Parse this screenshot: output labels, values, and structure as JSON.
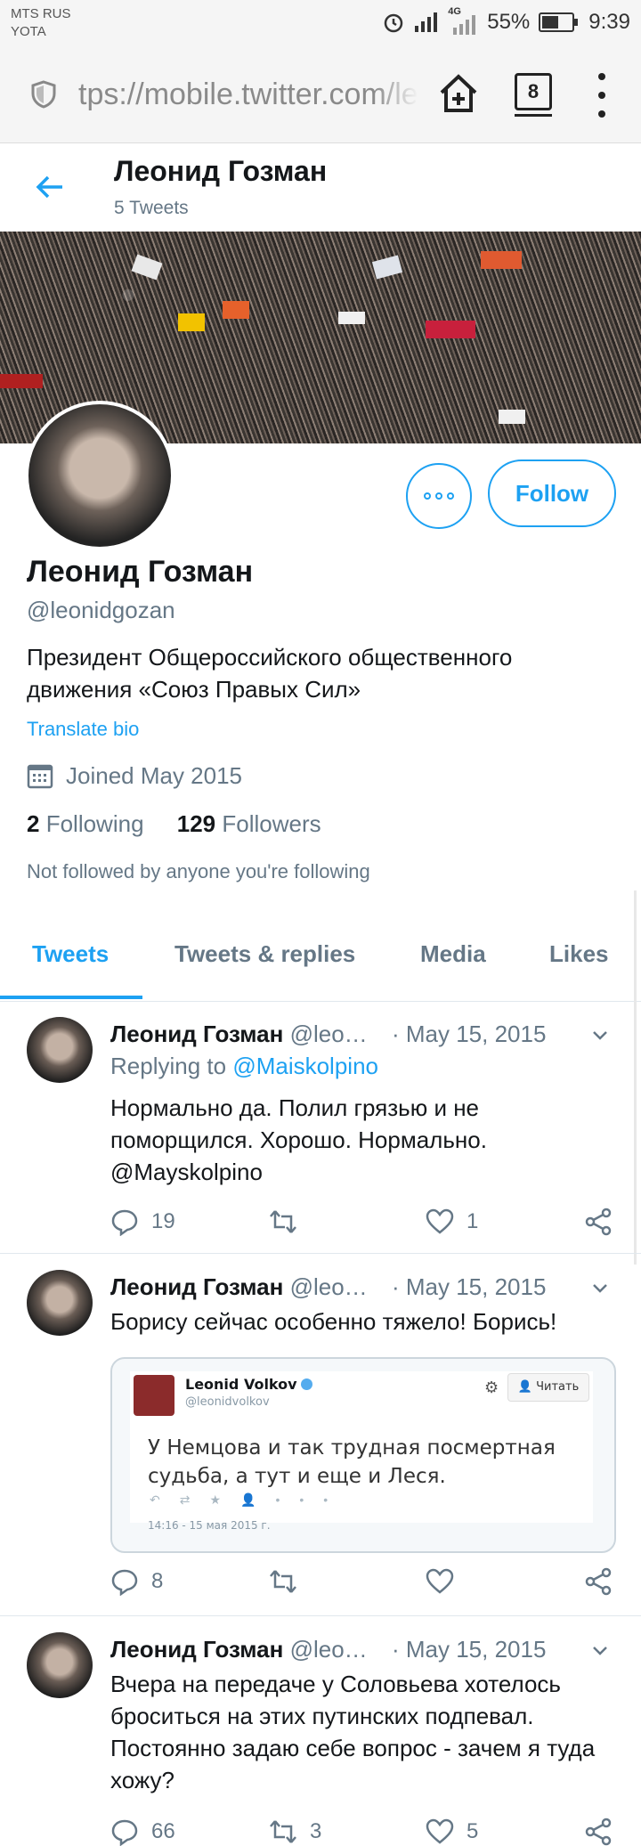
{
  "status_bar": {
    "carrier1": "MTS RUS",
    "carrier2": "YOTA",
    "network": "4G",
    "battery": "55%",
    "battery_level": 0.55,
    "time": "9:39"
  },
  "browser": {
    "url": "tps://mobile.twitter.com/le",
    "tab_count": "8"
  },
  "header": {
    "name": "Леонид Гозман",
    "tweet_count": "5 Tweets"
  },
  "profile": {
    "follow_label": "Follow",
    "name": "Леонид Гозман",
    "handle": "@leonidgozan",
    "bio": "Президент Общероссийского общественного движения «Союз Правых Сил»",
    "translate": "Translate bio",
    "joined": "Joined May 2015",
    "following_count": "2",
    "following_label": "Following",
    "followers_count": "129",
    "followers_label": "Followers",
    "not_followed": "Not followed by anyone you're following"
  },
  "tabs": [
    {
      "label": "Tweets"
    },
    {
      "label": "Tweets & replies"
    },
    {
      "label": "Media"
    },
    {
      "label": "Likes"
    }
  ],
  "tweets": [
    {
      "name": "Леонид Гозман",
      "handle": "@leo…",
      "date": "· May 15, 2015",
      "replying_prefix": "Replying to ",
      "replying_to": "@Maiskolpino",
      "text": "Нормально да. Полил грязью и не поморщился. Хорошо. Нормально. @Mayskolpino",
      "replies": "19",
      "retweets": "",
      "likes": "1"
    },
    {
      "name": "Леонид Гозман",
      "handle": "@leo…",
      "date": "· May 15, 2015",
      "text": "Борису сейчас особенно тяжело! Борись!",
      "embed": {
        "name": "Leonid Volkov",
        "handle": "@leonidvolkov",
        "follow_label": "Читать",
        "text": "У Немцова и так трудная посмертная судьба, а тут и еще и Леся.",
        "timestamp": "14:16 - 15 мая 2015 г."
      },
      "replies": "8",
      "retweets": "",
      "likes": ""
    },
    {
      "name": "Леонид Гозман",
      "handle": "@leo…",
      "date": "· May 15, 2015",
      "text": "Вчера на передаче у Соловьева хотелось броситься на этих путинских подпевал. Постоянно задаю себе вопрос - зачем я туда хожу?",
      "replies": "66",
      "retweets": "3",
      "likes": "5"
    }
  ],
  "colors": {
    "accent": "#1da1f2",
    "secondary_text": "#657786",
    "divider": "#e1e8ed"
  }
}
